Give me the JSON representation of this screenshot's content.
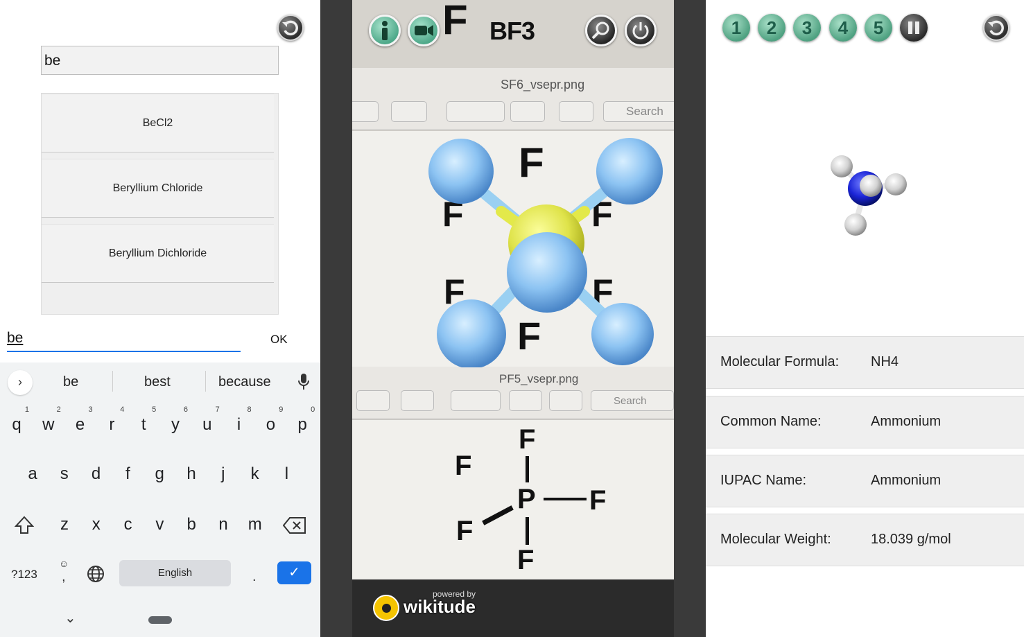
{
  "left_panel": {
    "reset_icon": "undo-icon",
    "search_value": "be",
    "results": [
      "BeCl2",
      "Beryllium Chloride",
      "Beryllium Dichloride"
    ],
    "input_value": "be",
    "ok_label": "OK"
  },
  "keyboard": {
    "suggestions": [
      "be",
      "best",
      "because"
    ],
    "row1": [
      {
        "k": "q",
        "n": "1"
      },
      {
        "k": "w",
        "n": "2"
      },
      {
        "k": "e",
        "n": "3"
      },
      {
        "k": "r",
        "n": "4"
      },
      {
        "k": "t",
        "n": "5"
      },
      {
        "k": "y",
        "n": "6"
      },
      {
        "k": "u",
        "n": "7"
      },
      {
        "k": "i",
        "n": "8"
      },
      {
        "k": "o",
        "n": "9"
      },
      {
        "k": "p",
        "n": "0"
      }
    ],
    "row2": [
      "a",
      "s",
      "d",
      "f",
      "g",
      "h",
      "j",
      "k",
      "l"
    ],
    "row3": [
      "z",
      "x",
      "c",
      "v",
      "b",
      "n",
      "m"
    ],
    "symbols_label": "?123",
    "emoji_glyph": "☺",
    "comma_glyph": ",",
    "period_glyph": ".",
    "space_label": "English",
    "enter_glyph": "✓",
    "collapse_glyph": "⌄"
  },
  "ar_view": {
    "title": "BF3",
    "doc1_name": "SF6_vsepr.png",
    "doc2_name": "PF5_vsepr.png",
    "search_placeholder": "Search",
    "powered_by": "powered by",
    "brand": "wikitude",
    "atom_labels": [
      "F",
      "F",
      "F",
      "F",
      "F",
      "F"
    ],
    "pf5_labels": [
      "F",
      "F",
      "P",
      "F",
      "F",
      "F"
    ]
  },
  "right_panel": {
    "numbers": [
      "1",
      "2",
      "3",
      "4",
      "5"
    ],
    "rows": [
      {
        "label": "Molecular Formula:",
        "value": "NH4"
      },
      {
        "label": "Common Name:",
        "value": "Ammonium"
      },
      {
        "label": "IUPAC Name:",
        "value": "Ammonium"
      },
      {
        "label": "Molecular Weight:",
        "value": "18.039 g/mol"
      }
    ]
  }
}
